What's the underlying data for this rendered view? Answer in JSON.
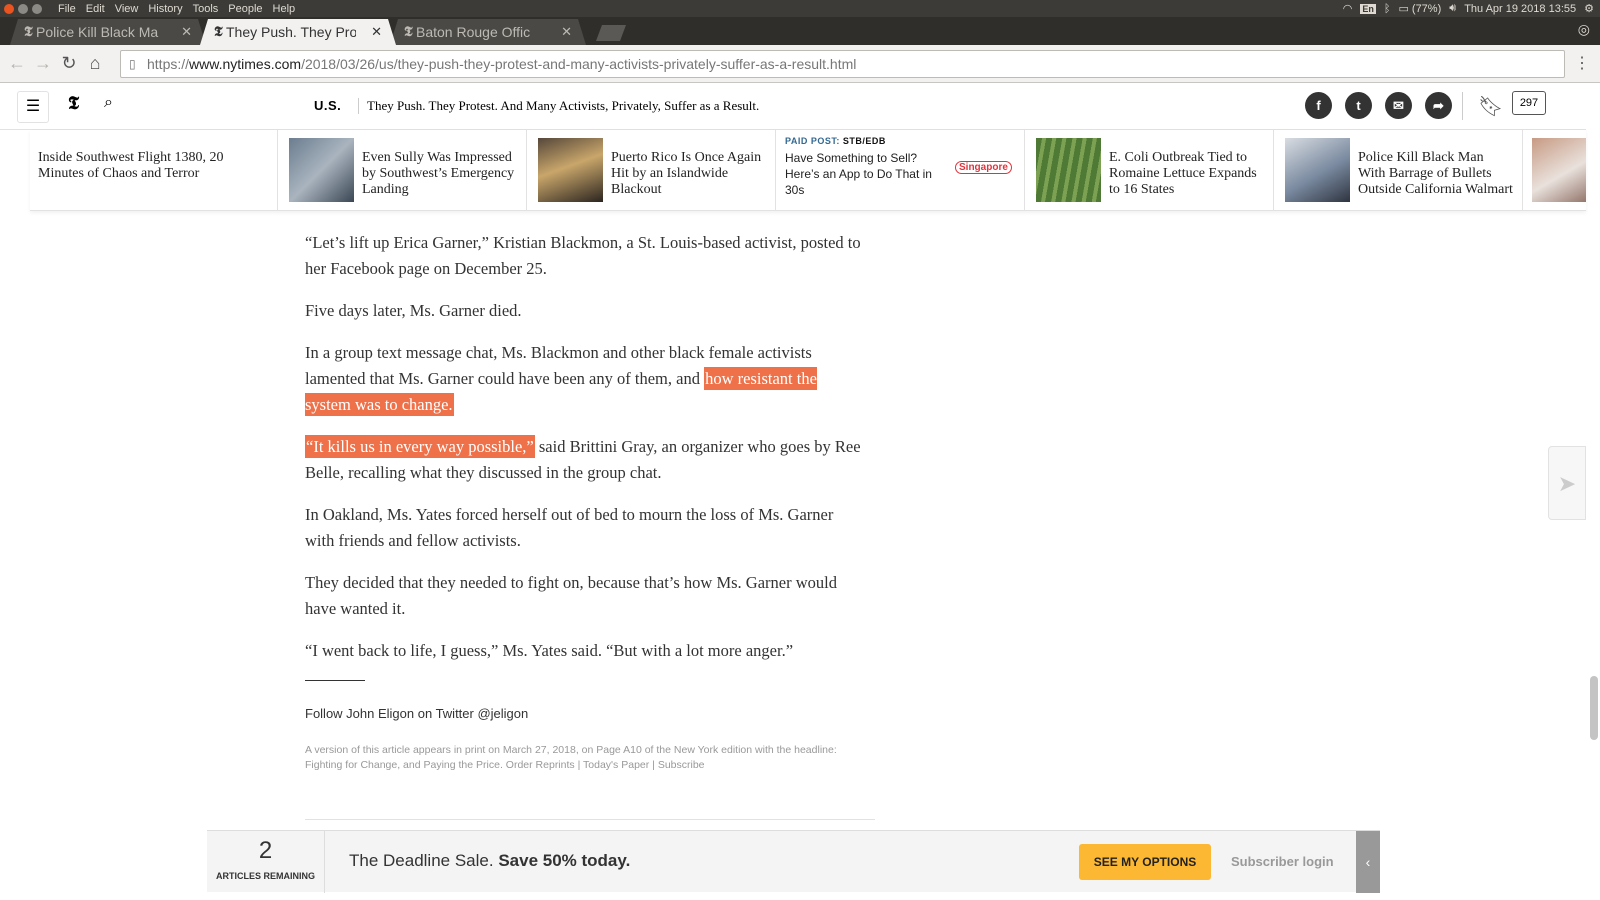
{
  "os": {
    "menu": [
      "File",
      "Edit",
      "View",
      "History",
      "Tools",
      "People",
      "Help"
    ],
    "tray": {
      "lang": "En",
      "battery": "(77%)",
      "datetime": "Thu Apr 19 2018 13:55"
    }
  },
  "browser": {
    "tabs": [
      {
        "title": "Police Kill Black Ma",
        "active": false
      },
      {
        "title": "They Push. They Pro",
        "active": true
      },
      {
        "title": "Baton Rouge Offic",
        "active": false
      }
    ],
    "url_scheme": "https://",
    "url_host": "www.nytimes.com",
    "url_path": "/2018/03/26/us/they-push-they-protest-and-many-activists-privately-suffer-as-a-result.html"
  },
  "masthead": {
    "section": "U.S.",
    "headline": "They Push. They Protest. And Many Activists, Privately, Suffer as a Result.",
    "comments_count": "297"
  },
  "ribbon": [
    {
      "text": "Inside Southwest Flight 1380, 20 Minutes of Chaos and Terror"
    },
    {
      "text": "Even Sully Was Impressed by Southwest’s Emergency Landing"
    },
    {
      "text": "Puerto Rico Is Once Again Hit by an Islandwide Blackout"
    },
    {
      "paid_label": "PAID POST:",
      "paid_sponsor": "STB/EDB",
      "text": "Have Something to Sell? Here’s an App to Do That in 30s",
      "logo": "Singapore"
    },
    {
      "text": "E. Coli Outbreak Tied to Romaine Lettuce Expands to 16 States"
    },
    {
      "text": "Police Kill Black Man With Barrage of Bullets Outside California Walmart"
    }
  ],
  "article": {
    "p1": "“Let’s lift up Erica Garner,” Kristian Blackmon, a St. Louis-based activist, posted to her Facebook page on December 25.",
    "p2": "Five days later, Ms. Garner died.",
    "p3_plain": "In a group text message chat, Ms. Blackmon and other black female activists lamented that Ms. Garner could have been any of them, and ",
    "p3_highlight": "how resistant the system was to change.",
    "p4_highlight": "“It kills us in every way possible,”",
    "p4_plain": " said Brittini Gray, an organizer who goes by Ree Belle, recalling what they discussed in the group chat.",
    "p5": "In Oakland, Ms. Yates forced herself out of bed to mourn the loss of Ms. Garner with friends and fellow activists.",
    "p6": "They decided that they needed to fight on, because that’s how Ms. Garner would have wanted it.",
    "p7": "“I went back to life, I guess,” Ms. Yates said. “But with a lot more anger.”",
    "follow": "Follow John Eligon on Twitter @jeligon",
    "print_version": "A version of this article appears in print on March 27, 2018, on Page A10 of the New York edition with the headline: Fighting for Change, and Paying the Price.",
    "print_links": [
      "Order Reprints",
      "Today's Paper",
      "Subscribe"
    ]
  },
  "paywall": {
    "count": "2",
    "count_label": "ARTICLES REMAINING",
    "offer_plain": "The Deadline Sale. ",
    "offer_bold": "Save 50% today.",
    "button": "SEE MY OPTIONS",
    "login": "Subscriber login"
  },
  "colors": {
    "highlight": "#ef7149",
    "cta": "#fcb832",
    "paid": "#326891"
  }
}
